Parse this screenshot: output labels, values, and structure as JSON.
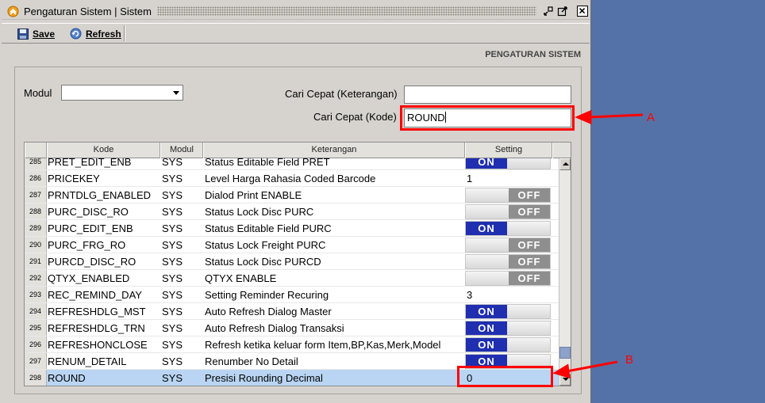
{
  "window": {
    "title": "Pengaturan Sistem | Sistem"
  },
  "toolbar": {
    "save_label": "Save",
    "refresh_label": "Refresh"
  },
  "header": {
    "label": "PENGATURAN SISTEM"
  },
  "filters": {
    "modul_label": "Modul",
    "modul_value": "",
    "keterangan_label": "Cari Cepat (Keterangan)",
    "keterangan_value": "",
    "kode_label": "Cari Cepat (Kode)",
    "kode_value": "ROUND"
  },
  "grid": {
    "columns": [
      "Kode",
      "Modul",
      "Keterangan",
      "Setting"
    ],
    "rows": [
      {
        "num": "285",
        "kode": "PRET_EDIT_ENB",
        "modul": "SYS",
        "keterangan": "Status Editable Field PRET",
        "setting": "ON",
        "type": "toggle"
      },
      {
        "num": "286",
        "kode": "PRICEKEY",
        "modul": "SYS",
        "keterangan": "Level Harga Rahasia Coded Barcode",
        "setting": "1",
        "type": "text"
      },
      {
        "num": "287",
        "kode": "PRNTDLG_ENABLED",
        "modul": "SYS",
        "keterangan": "Dialod Print ENABLE",
        "setting": "OFF",
        "type": "toggle"
      },
      {
        "num": "288",
        "kode": "PURC_DISC_RO",
        "modul": "SYS",
        "keterangan": "Status Lock Disc PURC",
        "setting": "OFF",
        "type": "toggle"
      },
      {
        "num": "289",
        "kode": "PURC_EDIT_ENB",
        "modul": "SYS",
        "keterangan": "Status Editable Field PURC",
        "setting": "ON",
        "type": "toggle"
      },
      {
        "num": "290",
        "kode": "PURC_FRG_RO",
        "modul": "SYS",
        "keterangan": "Status Lock Freight PURC",
        "setting": "OFF",
        "type": "toggle"
      },
      {
        "num": "291",
        "kode": "PURCD_DISC_RO",
        "modul": "SYS",
        "keterangan": "Status Lock Disc PURCD",
        "setting": "OFF",
        "type": "toggle"
      },
      {
        "num": "292",
        "kode": "QTYX_ENABLED",
        "modul": "SYS",
        "keterangan": "QTYX ENABLE",
        "setting": "OFF",
        "type": "toggle"
      },
      {
        "num": "293",
        "kode": "REC_REMIND_DAY",
        "modul": "SYS",
        "keterangan": "Setting Reminder Recuring",
        "setting": "3",
        "type": "text"
      },
      {
        "num": "294",
        "kode": "REFRESHDLG_MST",
        "modul": "SYS",
        "keterangan": "Auto Refresh Dialog Master",
        "setting": "ON",
        "type": "toggle"
      },
      {
        "num": "295",
        "kode": "REFRESHDLG_TRN",
        "modul": "SYS",
        "keterangan": "Auto Refresh Dialog Transaksi",
        "setting": "ON",
        "type": "toggle"
      },
      {
        "num": "296",
        "kode": "REFRESHONCLOSE",
        "modul": "SYS",
        "keterangan": "Refresh ketika keluar form Item,BP,Kas,Merk,Model",
        "setting": "ON",
        "type": "toggle"
      },
      {
        "num": "297",
        "kode": "RENUM_DETAIL",
        "modul": "SYS",
        "keterangan": "Renumber No Detail",
        "setting": "ON",
        "type": "toggle"
      },
      {
        "num": "298",
        "kode": "ROUND",
        "modul": "SYS",
        "keterangan": "Presisi Rounding Decimal",
        "setting": "0",
        "type": "text",
        "selected": true
      }
    ]
  },
  "annotations": {
    "a": "A",
    "b": "B"
  },
  "colors": {
    "toggle_on": "#1f2fb0",
    "toggle_off": "#8e8e8e",
    "annotation": "#ff0000",
    "selected_row": "#b9d5f3",
    "desktop": "#5572a8"
  }
}
